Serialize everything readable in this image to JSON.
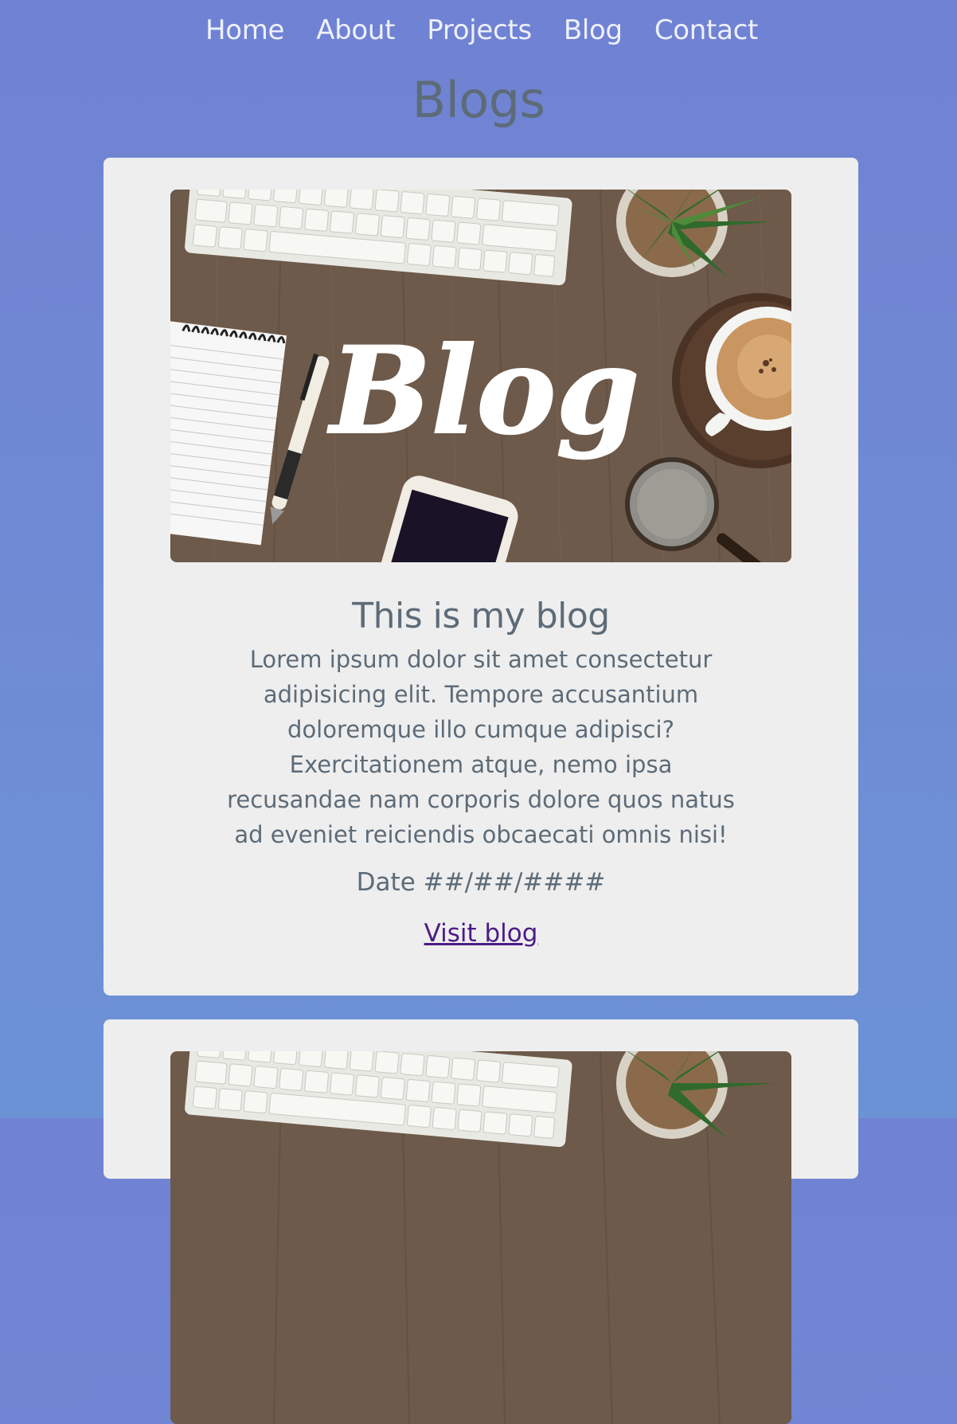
{
  "nav": {
    "items": [
      "Home",
      "About",
      "Projects",
      "Blog",
      "Contact"
    ]
  },
  "page": {
    "title": "Blogs"
  },
  "posts": [
    {
      "image_text": "Blog",
      "title": "This is my blog",
      "body": "Lorem ipsum dolor sit amet consectetur adipisicing elit. Tempore accusantium doloremque illo cumque adipisci? Exercitationem atque, nemo ipsa recusandae nam corporis dolore quos natus ad eveniet reiciendis obcaecati omnis nisi!",
      "date": "Date ##/##/####",
      "link": "Visit blog"
    }
  ],
  "colors": {
    "background": "#7082d3",
    "card": "#eeeeee",
    "text": "#5d6b78",
    "link": "#4b1c86",
    "nav_text": "#eef0fb",
    "photo_wood": "#6e5a4a"
  }
}
